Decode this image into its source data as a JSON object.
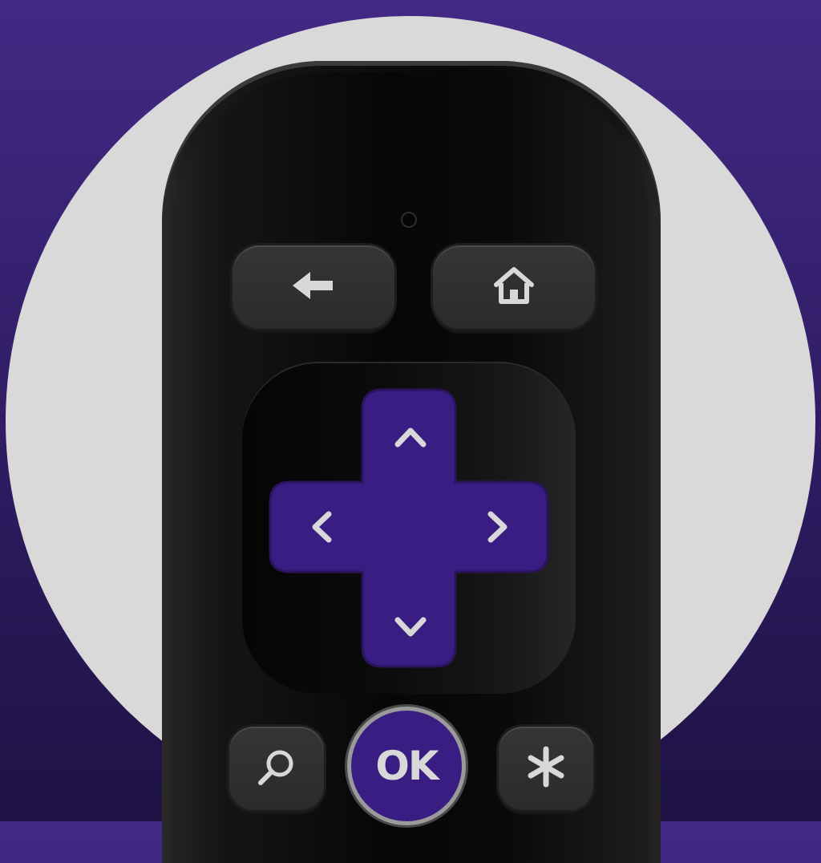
{
  "colors": {
    "background_top": "#432985",
    "background_bottom": "#1f1243",
    "circle": "#d9d9d9",
    "remote_body": "#0c0c0c",
    "dpad": "#3a1d82",
    "icon": "#d8d8d8"
  },
  "remote": {
    "buttons": {
      "back": {
        "icon": "arrow-left-icon"
      },
      "home": {
        "icon": "home-icon"
      },
      "dpad": {
        "up": {
          "icon": "chevron-up-icon"
        },
        "down": {
          "icon": "chevron-down-icon"
        },
        "left": {
          "icon": "chevron-left-icon"
        },
        "right": {
          "icon": "chevron-right-icon"
        }
      },
      "search": {
        "icon": "search-icon"
      },
      "ok": {
        "label": "OK"
      },
      "options": {
        "icon": "asterisk-icon"
      }
    }
  }
}
